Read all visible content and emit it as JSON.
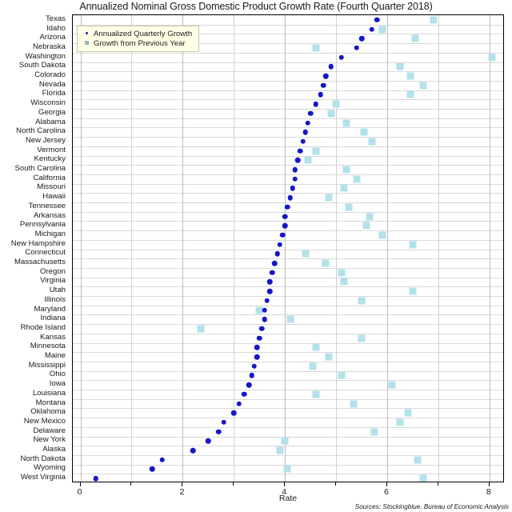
{
  "chart_data": {
    "type": "scatter",
    "title": "Annualized Nominal Gross Domestic Product Growth Rate (Fourth Quarter 2018)",
    "xlabel": "Rate",
    "ylabel": "",
    "xlim": [
      -0.15,
      8.3
    ],
    "xticks": [
      0,
      2,
      4,
      6,
      8
    ],
    "xticklabels": [
      "0",
      "2",
      "4",
      "6",
      "8"
    ],
    "grid": true,
    "legend_position": "top-left",
    "source": "Sources: Stockingblue, Bureau of Economic Analysis",
    "series": [
      {
        "name": "Annualized Quarterly Growth",
        "marker": "circle",
        "color": "#1616c8"
      },
      {
        "name": "Growth from Previous Year",
        "marker": "square",
        "color": "#b3e1ea"
      }
    ],
    "categories": [
      "Texas",
      "Idaho",
      "Arizona",
      "Nebraska",
      "Washington",
      "South Dakota",
      "Colorado",
      "Nevada",
      "Florida",
      "Wisconsin",
      "Georgia",
      "Alabama",
      "North Carolina",
      "New Jersey",
      "Vermont",
      "Kentucky",
      "South Carolina",
      "California",
      "Missouri",
      "Hawaii",
      "Tennessee",
      "Arkansas",
      "Pennsylvania",
      "Michigan",
      "New Hampshire",
      "Connecticut",
      "Massachusetts",
      "Oregon",
      "Virginia",
      "Utah",
      "Illinois",
      "Maryland",
      "Indiana",
      "Rhode Island",
      "Kansas",
      "Minnesota",
      "Maine",
      "Mississippi",
      "Ohio",
      "Iowa",
      "Louisiana",
      "Montana",
      "Oklahoma",
      "New Mexico",
      "Delaware",
      "New York",
      "Alaska",
      "North Dakota",
      "Wyoming",
      "West Virginia"
    ],
    "quarterly_growth": [
      5.8,
      5.7,
      5.5,
      5.4,
      5.1,
      4.9,
      4.8,
      4.75,
      4.7,
      4.6,
      4.5,
      4.45,
      4.4,
      4.35,
      4.3,
      4.25,
      4.2,
      4.2,
      4.15,
      4.1,
      4.05,
      4.0,
      4.0,
      3.95,
      3.9,
      3.85,
      3.8,
      3.75,
      3.7,
      3.7,
      3.65,
      3.6,
      3.6,
      3.55,
      3.5,
      3.45,
      3.45,
      3.4,
      3.35,
      3.3,
      3.2,
      3.1,
      3.0,
      2.8,
      2.7,
      2.5,
      2.2,
      1.6,
      1.4,
      0.3
    ],
    "previous_year_growth": [
      6.9,
      5.9,
      6.55,
      4.6,
      8.05,
      6.25,
      6.45,
      6.7,
      6.45,
      5.0,
      4.9,
      5.2,
      5.55,
      5.7,
      4.6,
      4.45,
      5.2,
      5.4,
      5.15,
      4.85,
      5.25,
      5.65,
      5.6,
      5.9,
      6.5,
      4.4,
      4.8,
      5.1,
      5.15,
      6.5,
      5.5,
      3.5,
      4.1,
      2.35,
      5.5,
      4.6,
      4.85,
      4.55,
      5.1,
      6.1,
      4.6,
      5.35,
      6.4,
      6.25,
      5.75,
      4.0,
      3.9,
      6.6,
      4.05,
      6.7
    ]
  }
}
